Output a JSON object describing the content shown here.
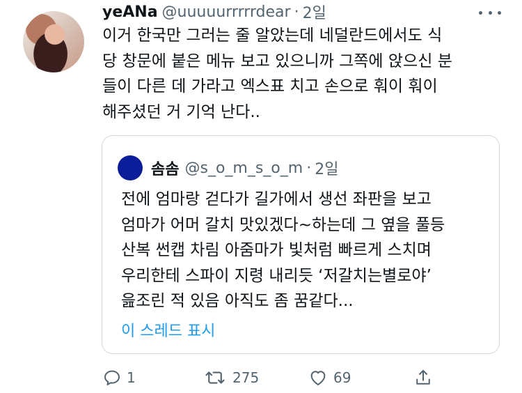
{
  "tweet": {
    "author_name": "yeANa",
    "author_handle": "@uuuuurrrrrdear",
    "separator": "·",
    "time": "2일",
    "text": "이거 한국만 그러는 줄 알았는데 네덜란드에서도 식\n당 창문에 붙은 메뉴 보고 있으니까 그쪽에 앉으신 분\n들이 다른 데 가라고 엑스표 치고 손으로 훠이 훠이\n해주셨던 거 기억 난다.."
  },
  "quote": {
    "author_name": "솜솜",
    "author_handle": "@s_o_m_s_o_m",
    "separator": "·",
    "time": "2일",
    "text": "전에 엄마랑 걷다가 길가에서 생선 좌판을 보고\n엄마가 어머 갈치 맛있겠다~하는데 그 옆을 풀등\n산복 썬캡 차림 아줌마가 빛처럼 빠르게 스치며\n우리한테 스파이 지령 내리듯 ‘저갈치는별로야’\n읊조린 적 있음 아직도 좀 꿈같다...",
    "show_thread": "이 스레드 표시",
    "avatar_color": "#0c1d9a"
  },
  "actions": {
    "reply_count": "1",
    "retweet_count": "275",
    "like_count": "69"
  },
  "colors": {
    "link": "#1d9bf0",
    "muted": "#536471",
    "border": "#cfd9de"
  }
}
